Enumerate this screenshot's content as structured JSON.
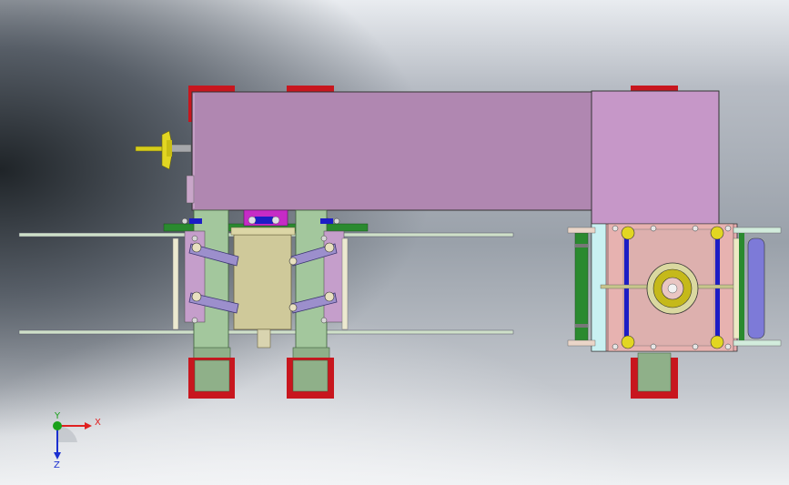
{
  "colors": {
    "bg_light": "#e6e9ee",
    "bg_mid": "#aeb4bd",
    "bg_dark": "#23282c",
    "frame_pink": "#b087b1",
    "frame_pink_right": "#c697c8",
    "feet_red": "#c8161e",
    "leg_green": "#a3c79d",
    "rail_green": "#2a8a2f",
    "cylinder_khaki": "#cfc99a",
    "link_purple": "#9c8fcc",
    "hopper_yellow": "#ddd21c",
    "plate_salmon": "#e8aeb0",
    "roller_blue": "#7d7ad8",
    "magenta_block": "#c62bc6",
    "axis_x": "#e02020",
    "axis_y": "#1aa11a",
    "axis_z": "#1b2fd0"
  },
  "triad": {
    "x_label": "X",
    "y_label": "Y",
    "z_label": "Z"
  }
}
